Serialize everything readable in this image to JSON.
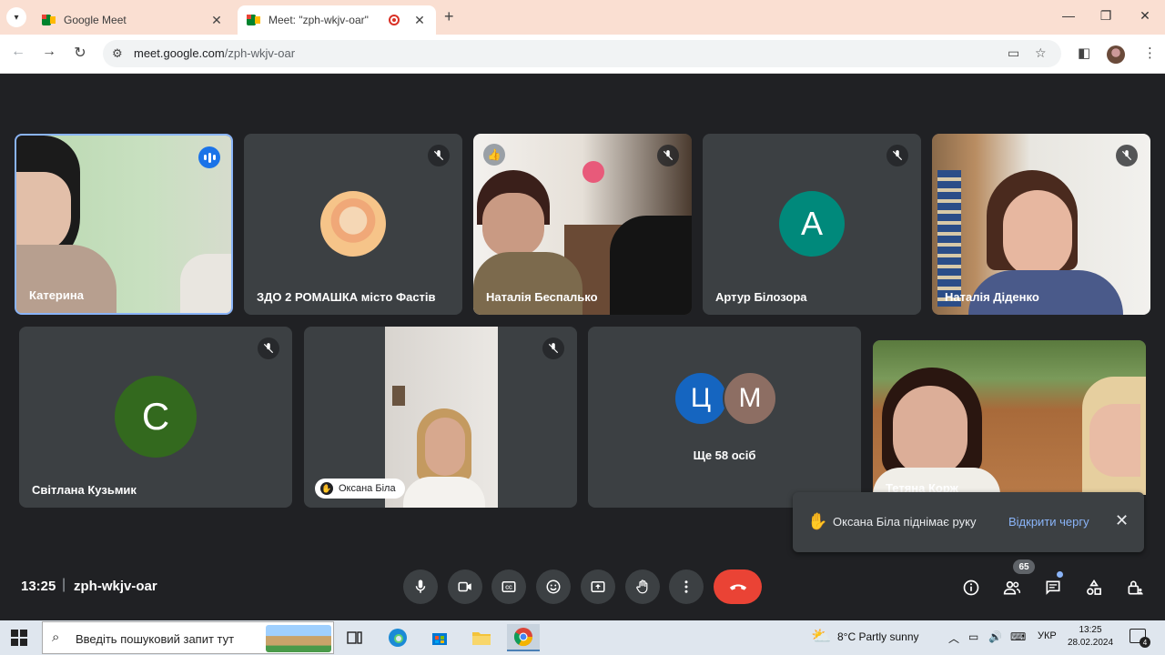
{
  "browser": {
    "tabs": [
      {
        "title": "Google Meet",
        "active": false
      },
      {
        "title": "Meet: \"zph-wkjv-oar\"",
        "active": true
      }
    ],
    "url_host": "meet.google.com",
    "url_path": "/zph-wkjv-oar"
  },
  "tiles": {
    "row1": [
      {
        "name": "Катерина",
        "type": "video",
        "speaking": true
      },
      {
        "name": "ЗДО 2 РОМАШКА місто Фастів",
        "type": "avatar-photo",
        "muted": true
      },
      {
        "name": "Наталія Беспалько",
        "type": "video",
        "muted": true,
        "reaction": "👍"
      },
      {
        "name": "Артур Білозора",
        "type": "avatar",
        "initial": "А",
        "color": "#00897b",
        "muted": true
      },
      {
        "name": "Наталія Діденко",
        "type": "video",
        "muted": true
      }
    ],
    "row2": [
      {
        "name": "Світлана Кузьмик",
        "type": "avatar",
        "initial": "С",
        "color": "#33691e",
        "muted": true
      },
      {
        "name": "Оксана Біла",
        "type": "video",
        "muted": true,
        "hand_raised": true
      },
      {
        "name": "Ще 58 осіб",
        "type": "others",
        "initials": [
          "Ц",
          "М"
        ],
        "colors": [
          "#1565c0",
          "#8d6e63"
        ]
      },
      {
        "name": "Тетяна Корж",
        "type": "video"
      }
    ]
  },
  "toast": {
    "message": "Оксана Біла піднімає руку",
    "action": "Відкрити чергу"
  },
  "meeting": {
    "time": "13:25",
    "code": "zph-wkjv-oar",
    "participant_count": "65"
  },
  "taskbar": {
    "search_placeholder": "Введіть пошуковий запит тут",
    "weather": "8°C  Partly sunny",
    "language": "УКР",
    "clock_time": "13:25",
    "clock_date": "28.02.2024",
    "notifications": "4"
  }
}
